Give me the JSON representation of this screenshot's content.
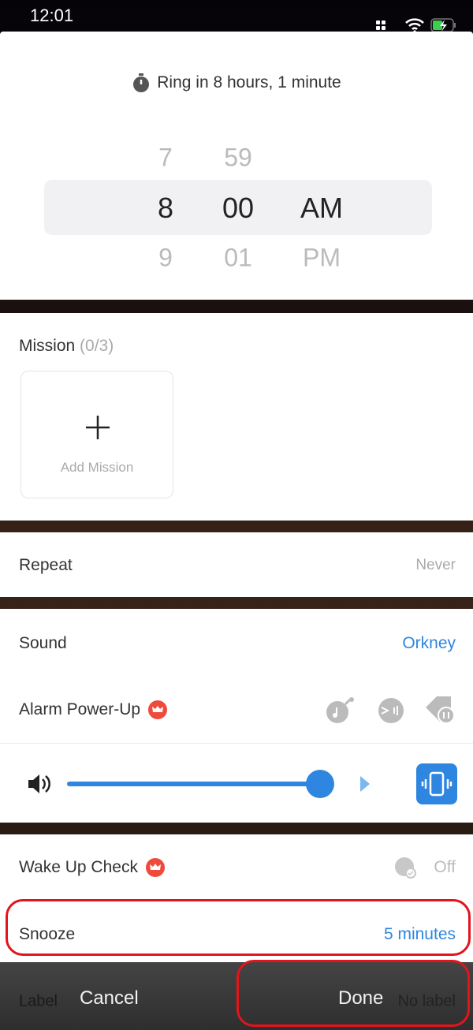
{
  "status_bar": {
    "time": "12:01"
  },
  "header": {
    "ring_text": "Ring in 8 hours, 1 minute",
    "icon": "stopwatch-icon"
  },
  "time_picker": {
    "hours": [
      "7",
      "8",
      "9"
    ],
    "minutes": [
      "59",
      "00",
      "01"
    ],
    "periods": [
      "AM",
      "PM"
    ],
    "selected": {
      "hour": "8",
      "minute": "00",
      "period": "AM"
    }
  },
  "mission": {
    "title": "Mission",
    "count": "(0/3)",
    "add_label": "Add Mission"
  },
  "repeat": {
    "label": "Repeat",
    "value": "Never"
  },
  "sound": {
    "label": "Sound",
    "value": "Orkney"
  },
  "power_up": {
    "label": "Alarm Power-Up"
  },
  "volume": {
    "level_percent": 100,
    "vibrate": true
  },
  "wake_up_check": {
    "label": "Wake Up Check",
    "value": "Off"
  },
  "snooze": {
    "label": "Snooze",
    "value": "5 minutes"
  },
  "label_row": {
    "label": "Label",
    "value": "No label"
  },
  "actions": {
    "cancel": "Cancel",
    "done": "Done"
  },
  "colors": {
    "accent": "#2f86e0",
    "highlight": "#e3141b",
    "premium": "#ef4a3c"
  }
}
